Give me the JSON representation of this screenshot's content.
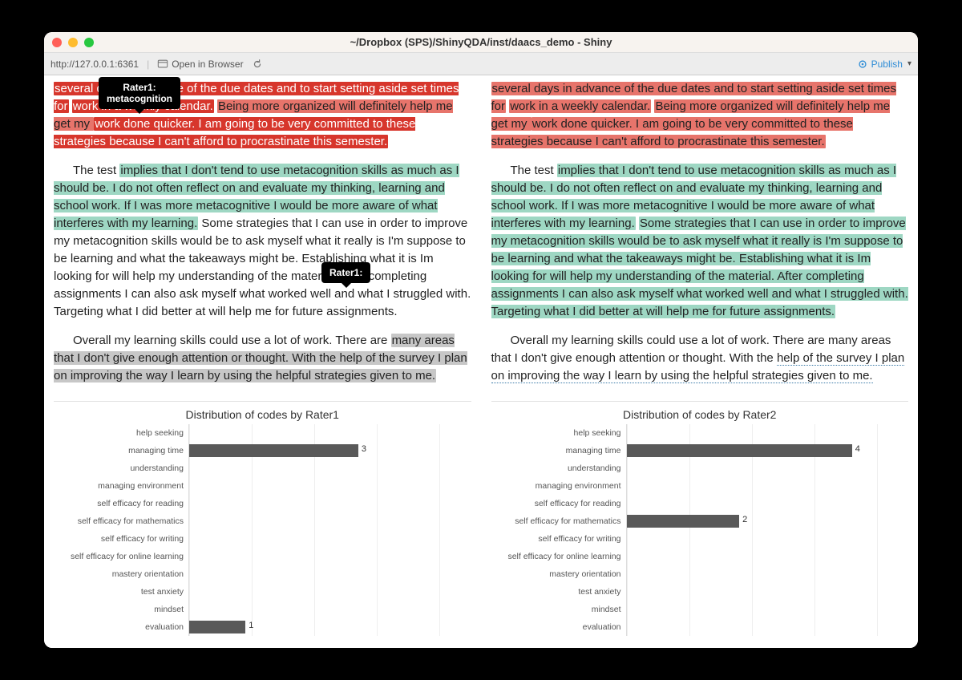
{
  "window": {
    "title": "~/Dropbox (SPS)/ShinyQDA/inst/daacs_demo - Shiny"
  },
  "toolbar": {
    "url": "http://127.0.0.1:6361",
    "open_in_browser": "Open in Browser",
    "publish": "Publish"
  },
  "tooltips": {
    "t1": "Rater1:\nmetacognition",
    "t2": "Rater1:"
  },
  "text": {
    "p1_top_a": "several days in advance of the due dates and to start setting aside set times for",
    "p1_top_b": "work in a weekly calendar.",
    "p1_top_c": " Being more organized will definitely help me get my ",
    "p1_top_d": "work done quicker. I am going to be very committed to these strategies because I can't afford to procrastinate this semester.",
    "p2_pre": "The test ",
    "p2_hl_a": "implies that I don't tend to use metacognition skills as much as I should be. I do not often reflect on and evaluate my thinking, learning and school work. If I was more metacognitive I would be more aware of what interferes with my learning.",
    "p2_mid_a": "Some strategies that I can use in order to improve my metacognition skills would be to ask myself what it really is I'm suppose to be learning and what the takeaways might be. Establishing what it is Im looking for will help my understanding of the material. After completing assignments I can also ask myself what worked well and what I struggled with. Targeting what I did better at will help me for future assignments.",
    "p2_right_extra": "Some strategies that I can use in order to improve my metacognition skills would be to ask myself what it really is I'm suppose to be learning and what the takeaways might be. Establishing what it is Im looking for will help my understanding of the material. After completing assignments I can also ask myself what worked well and what I struggled with. Targeting what I did better at will help me for future assignments.",
    "p3_pre": "Overall my learning skills could use a lot of work. There are ",
    "p3_hl": "many areas that I don't give enough attention or thought. With the help of the survey I plan on improving the way I learn by using the helpful strategies given to me.",
    "p3_right_pre": "Overall my learning skills could use a lot of work. There are many areas that I don't give enough attention or thought. With the ",
    "p3_right_dotted": "help of the survey I plan on improving the way I learn by using the helpful strategies given to me."
  },
  "charts": {
    "titles": {
      "left": "Distribution of codes by Rater1",
      "right": "Distribution of codes by Rater2"
    }
  },
  "chart_data": [
    {
      "type": "bar",
      "title": "Distribution of codes by Rater1",
      "xlabel": "",
      "ylabel": "",
      "xlim": [
        0,
        5
      ],
      "categories": [
        "help seeking",
        "managing time",
        "understanding",
        "managing environment",
        "self efficacy for reading",
        "self efficacy for mathematics",
        "self efficacy for writing",
        "self efficacy for online learning",
        "mastery orientation",
        "test anxiety",
        "mindset",
        "evaluation"
      ],
      "values": [
        0,
        3,
        0,
        0,
        0,
        0,
        0,
        0,
        0,
        0,
        0,
        1
      ]
    },
    {
      "type": "bar",
      "title": "Distribution of codes by Rater2",
      "xlabel": "",
      "ylabel": "",
      "xlim": [
        0,
        5
      ],
      "categories": [
        "help seeking",
        "managing time",
        "understanding",
        "managing environment",
        "self efficacy for reading",
        "self efficacy for mathematics",
        "self efficacy for writing",
        "self efficacy for online learning",
        "mastery orientation",
        "test anxiety",
        "mindset",
        "evaluation"
      ],
      "values": [
        0,
        4,
        0,
        0,
        0,
        2,
        0,
        0,
        0,
        0,
        0,
        0
      ]
    }
  ]
}
